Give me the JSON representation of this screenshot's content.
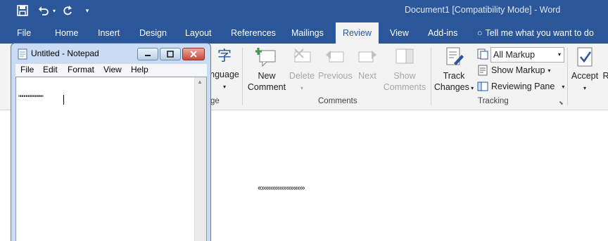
{
  "word": {
    "title": "Document1 [Compatibility Mode]  -  Word",
    "tabs": [
      "File",
      "Home",
      "Insert",
      "Design",
      "Layout",
      "References",
      "Mailings",
      "Review",
      "View",
      "Add-ins"
    ],
    "active_tab": "Review",
    "tell_me": "Tell me what you want to do",
    "ribbon": {
      "language_label": "nguage",
      "language_group_fragment": "ge",
      "new_comment": [
        "New",
        "Comment"
      ],
      "delete": "Delete",
      "previous": "Previous",
      "next": "Next",
      "show_comments": [
        "Show",
        "Comments"
      ],
      "comments_group": "Comments",
      "track_changes": [
        "Track",
        "Changes"
      ],
      "markup_select": "All Markup",
      "show_markup": "Show Markup",
      "reviewing_pane": "Reviewing Pane",
      "tracking_group": "Tracking",
      "accept": "Accept",
      "reject_fragment": "R"
    },
    "document_text": "«»»»»»»»»»»»»"
  },
  "notepad": {
    "title": "Untitled - Notepad",
    "menu": [
      "File",
      "Edit",
      "Format",
      "View",
      "Help"
    ],
    "text": "\"\"\"\"\"\"\"\"\"\"\"\""
  },
  "colors": {
    "word_blue": "#2b579a",
    "ribbon_bg": "#f3f3f3",
    "notepad_frame": "#c9dcf3",
    "close_red": "#c94a3c"
  }
}
